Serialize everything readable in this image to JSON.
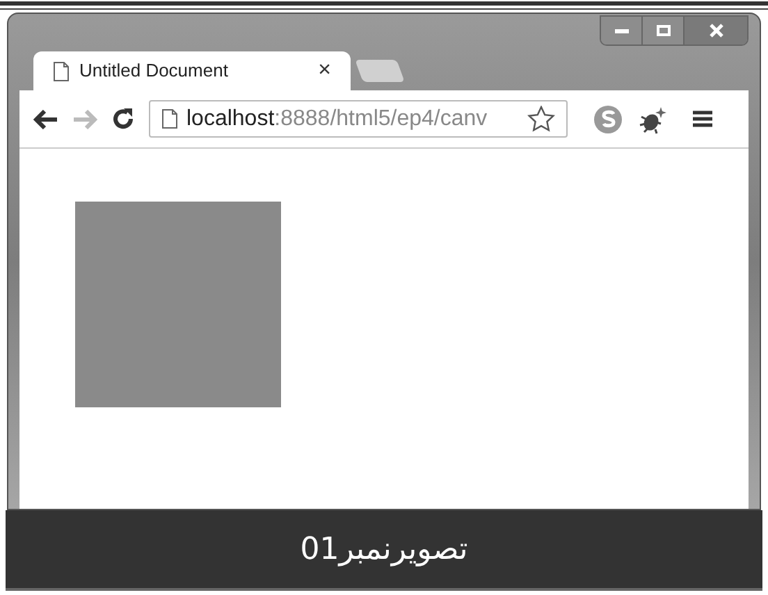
{
  "tab": {
    "title": "Untitled Document",
    "close": "×",
    "selected": true
  },
  "toolbar": {
    "forward_disabled": true,
    "url_host": "localhost",
    "url_path": ":8888/html5/ep4/canv"
  },
  "caption": "تصویرنمبر01"
}
